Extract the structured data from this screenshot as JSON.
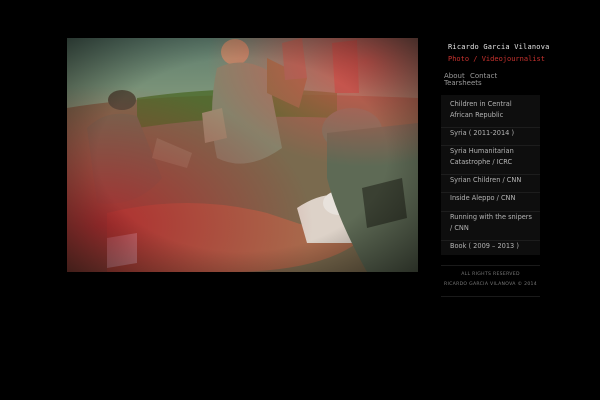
{
  "site": {
    "title": "Ricardo Garcia Vilanova",
    "subtitle": "Photo / Videojournalist"
  },
  "nav": {
    "about": "About",
    "contact": "Contact",
    "tearsheets": "Tearsheets"
  },
  "galleries": [
    "Children in Central African Republic",
    "Syria ( 2011-2014 )",
    "Syria Humanitarian Catastrophe / ICRC",
    "Syrian Children / CNN",
    "Inside Aleppo / CNN",
    "Running with the snipers / CNN",
    "Book ( 2009 – 2013 )"
  ],
  "footer": {
    "rights": "ALL RIGHTS RESERVED",
    "copyright": "RICARDO GARCIA VILANOVA © 2014"
  },
  "colors": {
    "background": "#000000",
    "subtitle": "#c8322e",
    "list_bg": "#0e0e0e"
  }
}
